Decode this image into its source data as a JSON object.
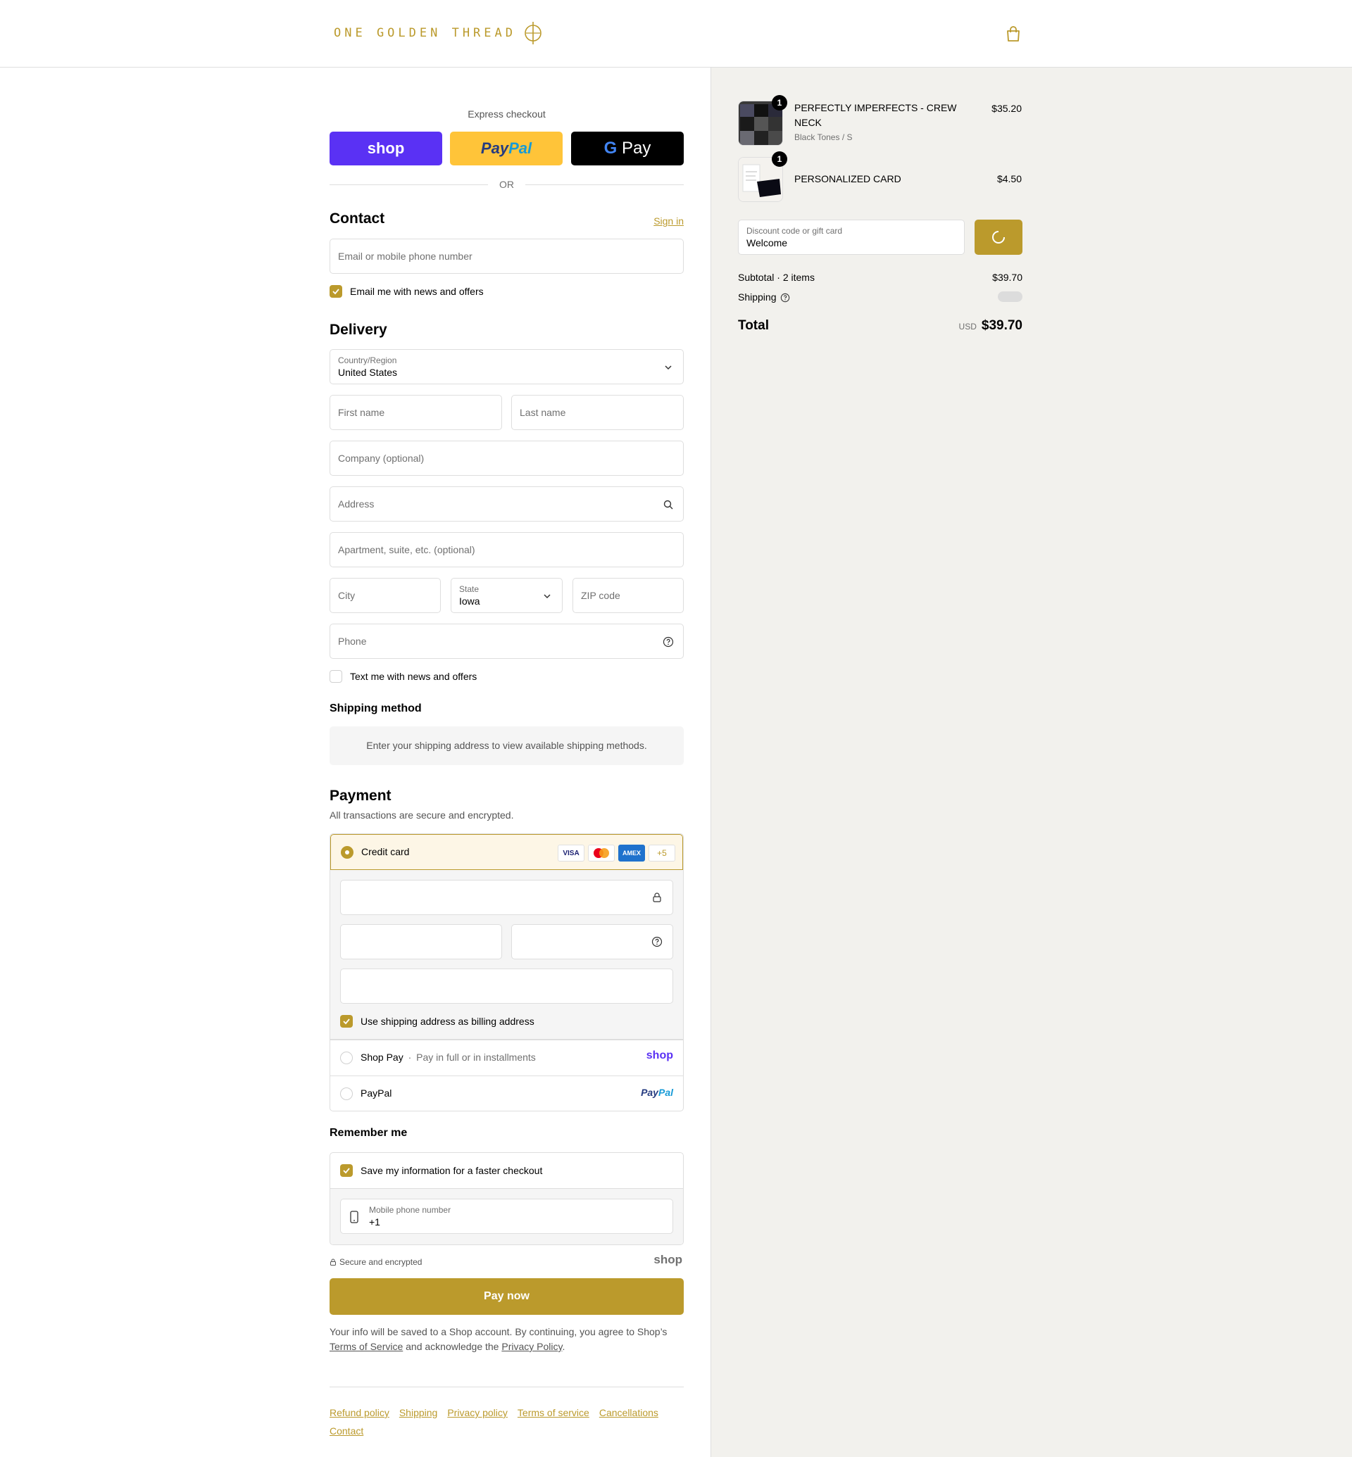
{
  "header": {
    "brand": "ONE GOLDEN THREAD"
  },
  "express": {
    "label": "Express checkout",
    "shop_label": "shop",
    "paypal_label_1": "Pay",
    "paypal_label_2": "Pal",
    "gpay_label_g": "G",
    "gpay_label": "Pay",
    "or_label": "OR"
  },
  "contact": {
    "title": "Contact",
    "sign_in": "Sign in",
    "email_placeholder": "Email or mobile phone number",
    "email_news_label": "Email me with news and offers",
    "email_news_checked": true
  },
  "delivery": {
    "title": "Delivery",
    "country_label": "Country/Region",
    "country_value": "United States",
    "first_name_placeholder": "First name",
    "last_name_placeholder": "Last name",
    "company_placeholder": "Company (optional)",
    "address_placeholder": "Address",
    "apartment_placeholder": "Apartment, suite, etc. (optional)",
    "city_placeholder": "City",
    "state_label": "State",
    "state_value": "Iowa",
    "zip_placeholder": "ZIP code",
    "phone_placeholder": "Phone",
    "text_news_label": "Text me with news and offers",
    "text_news_checked": false
  },
  "shipping_method": {
    "title": "Shipping method",
    "message": "Enter your shipping address to view available shipping methods."
  },
  "payment": {
    "title": "Payment",
    "subtitle": "All transactions are secure and encrypted.",
    "credit_card_label": "Credit card",
    "card_brands": [
      "VISA",
      "Mastercard",
      "AMEX"
    ],
    "more_cards": "+5",
    "billing_label": "Use shipping address as billing address",
    "billing_checked": true,
    "shop_pay_label": "Shop Pay",
    "shop_pay_sep": "·",
    "shop_pay_desc": "Pay in full or in installments",
    "shop_pay_logo": "shop",
    "paypal_label": "PayPal",
    "paypal_logo_1": "Pay",
    "paypal_logo_2": "Pal"
  },
  "remember": {
    "title": "Remember me",
    "save_label": "Save my information for a faster checkout",
    "save_checked": true,
    "mobile_label": "Mobile phone number",
    "mobile_value": "+1",
    "secure_label": "Secure and encrypted",
    "shop_logo": "shop"
  },
  "pay_now": "Pay now",
  "legal": {
    "text_1": "Your info will be saved to a Shop account. By continuing, you agree to Shop’s",
    "terms": "Terms of Service",
    "text_2": " and acknowledge the ",
    "privacy": "Privacy Policy",
    "text_3": "."
  },
  "footer": {
    "links": [
      "Refund policy",
      "Shipping",
      "Privacy policy",
      "Terms of service",
      "Cancellations",
      "Contact"
    ]
  },
  "summary": {
    "items": [
      {
        "name": "PERFECTLY IMPERFECTS - CREW NECK",
        "variant": "Black Tones / S",
        "price": "$35.20",
        "qty": "1"
      },
      {
        "name": "PERSONALIZED CARD",
        "variant": "",
        "price": "$4.50",
        "qty": "1"
      }
    ],
    "discount_label": "Discount code or gift card",
    "discount_value": "Welcome",
    "subtotal_label": "Subtotal · 2 items",
    "subtotal_value": "$39.70",
    "shipping_label": "Shipping",
    "total_label": "Total",
    "currency": "USD",
    "total_value": "$39.70"
  },
  "colors": {
    "accent": "#bb9a2c",
    "shop": "#5a31f4",
    "paypal_yellow": "#ffc439",
    "summary_bg": "#f2f1ed"
  }
}
